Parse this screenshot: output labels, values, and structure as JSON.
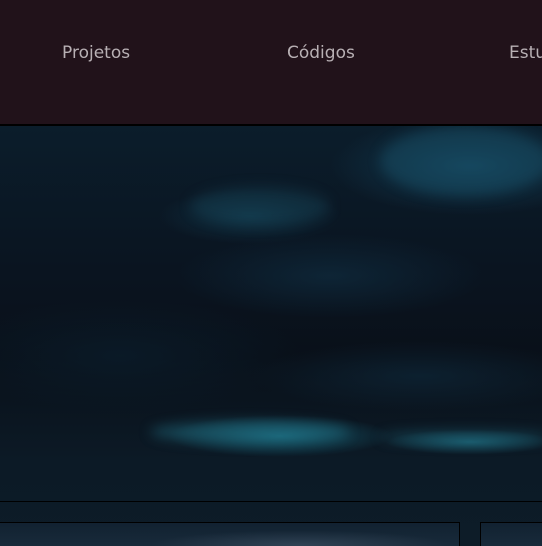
{
  "nav": {
    "items": [
      {
        "label": "Projetos"
      },
      {
        "label": "Códigos"
      },
      {
        "label": "Estu"
      }
    ]
  },
  "colors": {
    "navbar_background": "#21121a",
    "nav_text": "#b8b0b4",
    "hero_sky": "#0a1420",
    "cloud_highlight": "#19697d"
  },
  "hero": {
    "image": "night-sky-clouds-image"
  }
}
